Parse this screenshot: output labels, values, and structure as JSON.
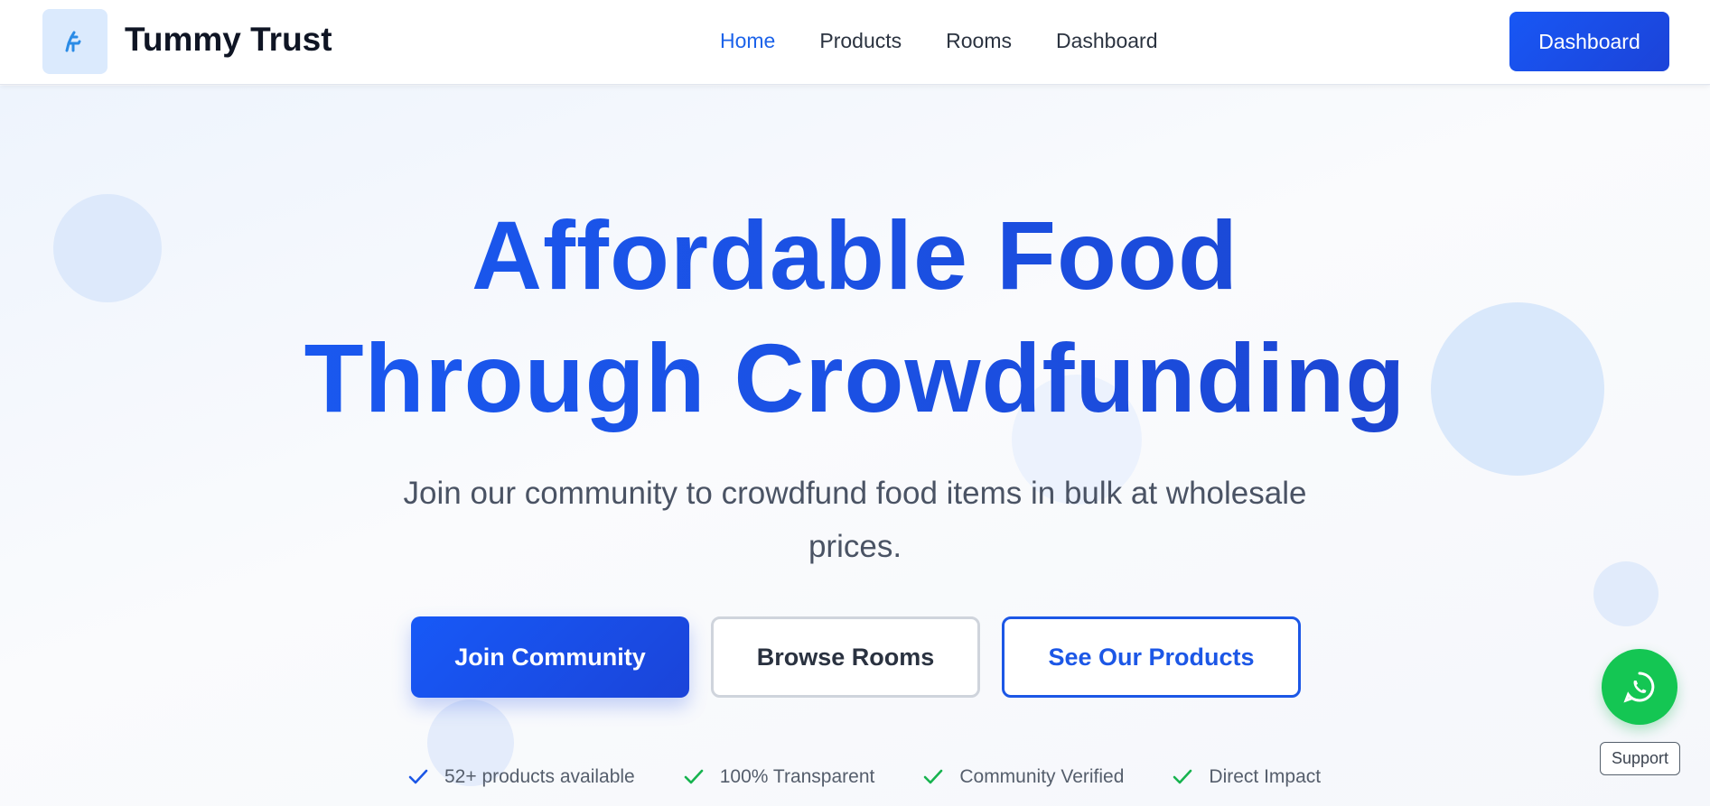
{
  "brand": {
    "name": "Tummy Trust",
    "logo_icon": "utensils-icon",
    "logo_bg": "#dbeafd",
    "logo_color": "#2a8be6"
  },
  "nav": {
    "links": [
      {
        "label": "Home",
        "active": true
      },
      {
        "label": "Products",
        "active": false
      },
      {
        "label": "Rooms",
        "active": false
      },
      {
        "label": "Dashboard",
        "active": false
      }
    ],
    "cta_label": "Dashboard"
  },
  "hero": {
    "headline_line1": "Affordable Food",
    "headline_line2": "Through Crowdfunding",
    "subtitle": "Join our community to crowdfund food items in bulk at wholesale prices.",
    "buttons": {
      "join": "Join Community",
      "browse": "Browse Rooms",
      "products": "See Our Products"
    },
    "features": [
      {
        "label": "52+ products available",
        "icon": "check-icon",
        "color": "#1c57e6"
      },
      {
        "label": "100% Transparent",
        "icon": "check-icon",
        "color": "#17b34f"
      },
      {
        "label": "Community Verified",
        "icon": "check-icon",
        "color": "#17b34f"
      },
      {
        "label": "Direct Impact",
        "icon": "check-icon",
        "color": "#17b34f"
      }
    ]
  },
  "support": {
    "label": "Support",
    "icon": "whatsapp-icon",
    "color": "#14c653"
  },
  "colors": {
    "accent": "#1c57e6",
    "text_dark": "#0f1524",
    "text_muted": "#4a5364"
  }
}
